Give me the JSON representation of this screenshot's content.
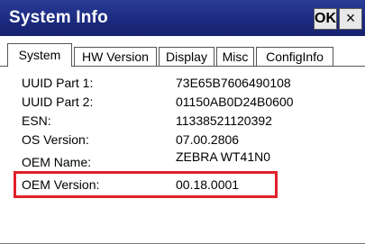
{
  "window": {
    "title": "System Info",
    "ok_label": "OK",
    "close_label": "×"
  },
  "tabs": [
    {
      "label": "System",
      "active": true
    },
    {
      "label": "HW Version",
      "active": false
    },
    {
      "label": "Display",
      "active": false
    },
    {
      "label": "Misc",
      "active": false
    },
    {
      "label": "ConfigInfo",
      "active": false
    }
  ],
  "rows": [
    {
      "label": "UUID Part 1:",
      "value": "73E65B7606490108"
    },
    {
      "label": "UUID Part 2:",
      "value": "01150AB0D24B0600"
    },
    {
      "label": "ESN:",
      "value": "11338521120392"
    },
    {
      "label": "OS Version:",
      "value": "07.00.2806"
    },
    {
      "label": "OEM Name:",
      "value": "ZEBRA WT41N0"
    },
    {
      "label": "OEM Version:",
      "value": "00.18.0001"
    }
  ],
  "colors": {
    "titlebar": "#1c2a80",
    "highlight": "#e0202a"
  }
}
